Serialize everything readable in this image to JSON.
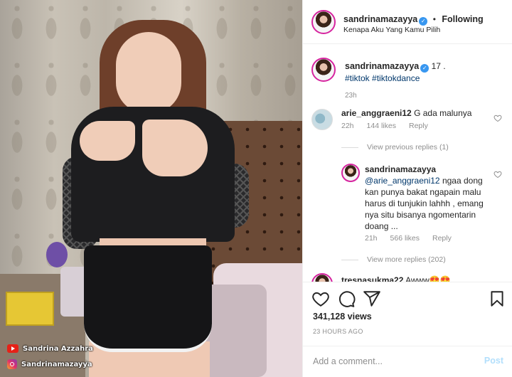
{
  "media": {
    "watermark_youtube": "Sandrina Azzahra",
    "watermark_instagram": "Sandrinamazayya"
  },
  "header": {
    "username": "sandrinamazayya",
    "separator": "•",
    "follow_status": "Following",
    "subtitle": "Kenapa Aku Yang Kamu Pilih"
  },
  "caption": {
    "username": "sandrinamazayya",
    "text": "17 .",
    "tags": [
      "#tiktok",
      "#tiktokdance"
    ],
    "time": "23h"
  },
  "comments": [
    {
      "username": "arie_anggraeni12",
      "text": "G ada malunya",
      "time": "22h",
      "likes": "144 likes",
      "reply": "Reply",
      "view_replies": "View previous replies (1)"
    },
    {
      "username": "sandrinamazayya",
      "mention": "@arie_anggraeni12",
      "text": "ngaa dong kan punya bakat ngapain malu harus di tunjukin lahhh , emang nya situ bisanya ngomentarin doang ...",
      "time": "21h",
      "likes": "566 likes",
      "reply": "Reply",
      "view_more": "View more replies (202)"
    },
    {
      "username": "tresnasukma22",
      "text": "Awww😍😍"
    }
  ],
  "actions": {
    "views": "341,128 views",
    "time_ago": "23 HOURS AGO"
  },
  "add_comment": {
    "placeholder": "Add a comment...",
    "post_label": "Post"
  },
  "colors": {
    "link": "#00376b",
    "verified": "#3897f0",
    "muted": "#8e8e8e",
    "post_disabled": "#b2dffc"
  }
}
